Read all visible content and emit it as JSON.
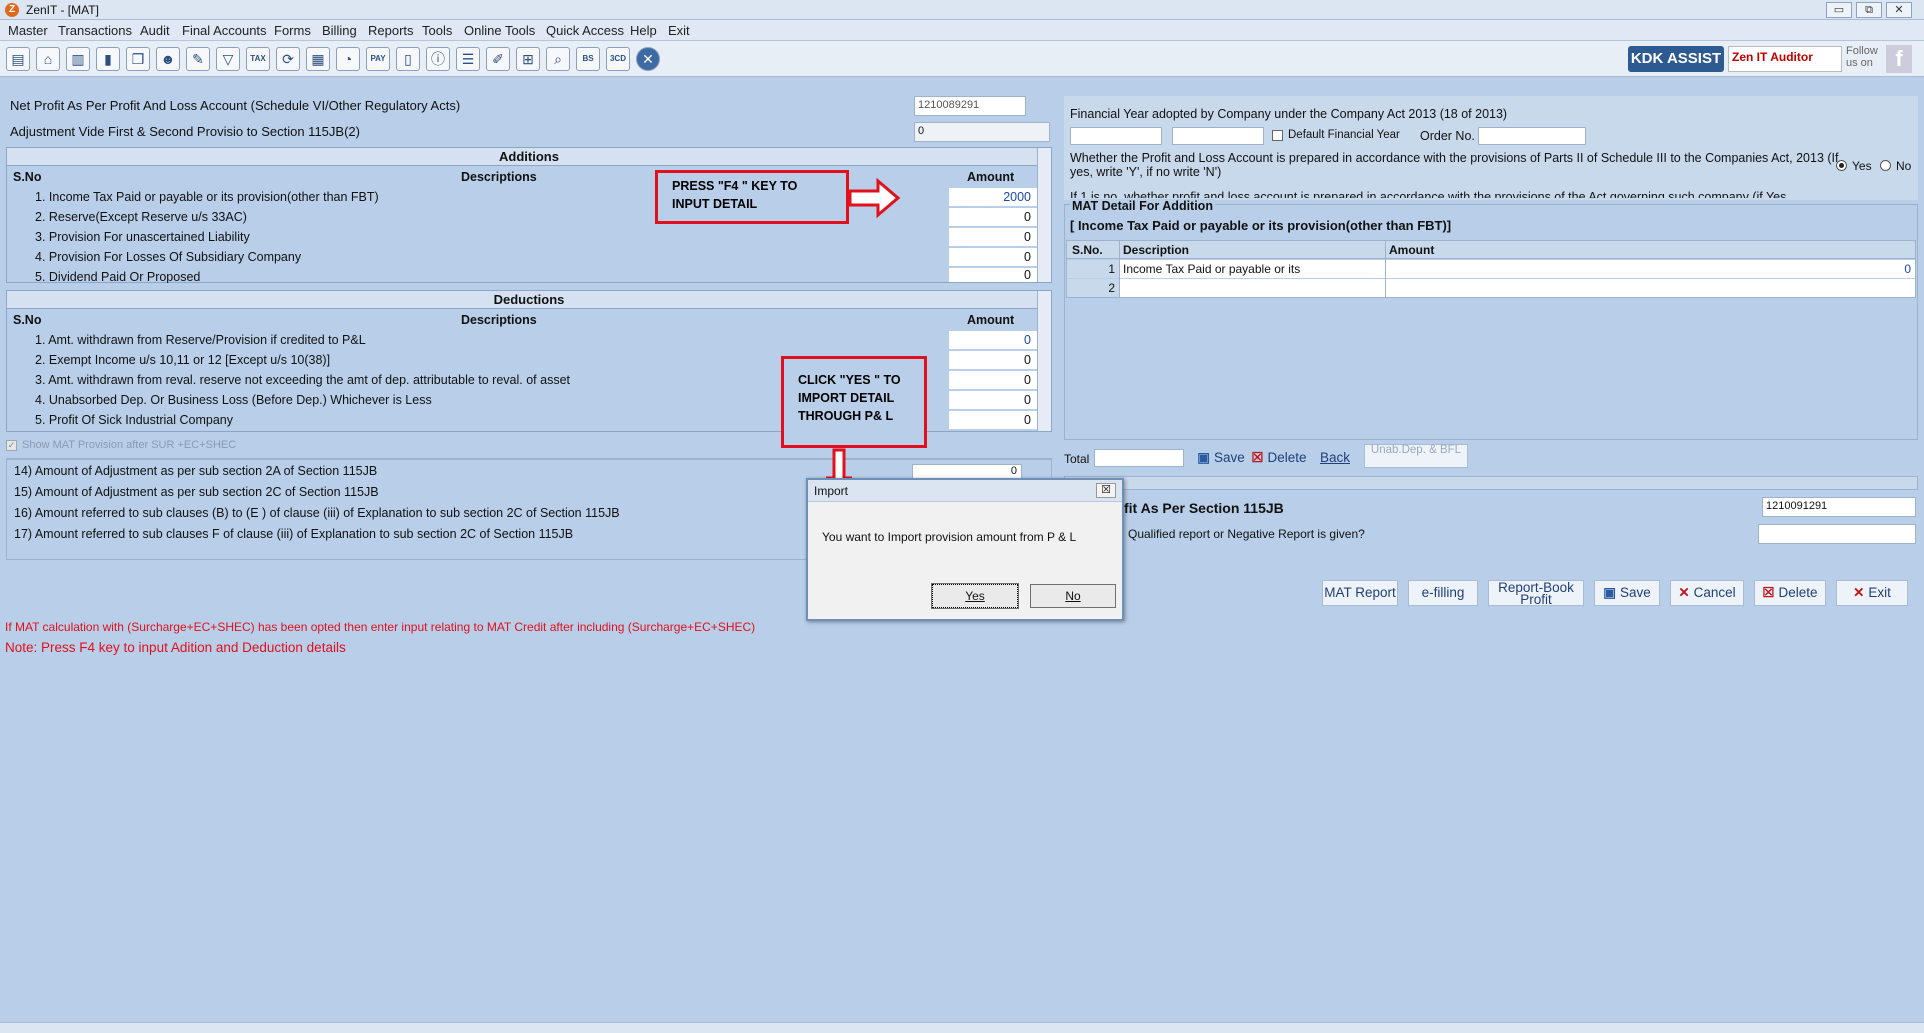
{
  "window": {
    "title": "ZenIT - [MAT]",
    "app_icon": "Z",
    "min": "▭",
    "restore": "⧉",
    "close": "✕"
  },
  "menu": [
    "Master",
    "Transactions",
    "Audit",
    "Final Accounts",
    "Forms",
    "Billing",
    "Reports",
    "Tools",
    "Online Tools",
    "Quick Access",
    "Help",
    "Exit"
  ],
  "toolbar": {
    "tax_label": "TAX",
    "bs_label": "BS",
    "sd_label": "3CD",
    "pay_label": "PAY"
  },
  "brand": {
    "kdk": "KDK ASSIST",
    "zen": "Zen IT Auditor",
    "follow": "Follow us on",
    "fb": "f"
  },
  "top": {
    "net_profit_label": "Net Profit As Per Profit And Loss Account (Schedule VI/Other Regulatory Acts)",
    "net_profit_value": "1210089291",
    "adjustment_label": "Adjustment Vide First & Second Provisio to Section 115JB(2)",
    "adjustment_value": "0"
  },
  "additions": {
    "title": "Additions",
    "col_sno": "S.No",
    "col_desc": "Descriptions",
    "col_amt": "Amount",
    "rows": [
      {
        "label": "1.  Income Tax Paid or payable or its provision(other than FBT)",
        "amount": "2000"
      },
      {
        "label": "2.  Reserve(Except Reserve u/s 33AC)",
        "amount": "0"
      },
      {
        "label": "3.  Provision For unascertained Liability",
        "amount": "0"
      },
      {
        "label": "4.  Provision For Losses Of Subsidiary Company",
        "amount": "0"
      },
      {
        "label": "5.  Dividend Paid Or Proposed",
        "amount": "0"
      }
    ]
  },
  "deductions": {
    "title": "Deductions",
    "col_sno": "S.No",
    "col_desc": "Descriptions",
    "col_amt": "Amount",
    "rows": [
      {
        "label": "1.  Amt. withdrawn from Reserve/Provision if credited to P&L",
        "amount": "0"
      },
      {
        "label": "2.  Exempt Income u/s 10,11 or 12 [Except u/s 10(38)]",
        "amount": "0"
      },
      {
        "label": "3.  Amt. withdrawn from reval. reserve not exceeding the amt of dep. attributable to reval. of asset",
        "amount": "0"
      },
      {
        "label": "4.  Unabsorbed Dep. Or Business Loss (Before Dep.) Whichever is Less",
        "amount": "0"
      },
      {
        "label": "5.  Profit Of Sick Industrial Company",
        "amount": "0"
      }
    ]
  },
  "show_mat_label": "Show MAT Provision after SUR +EC+SHEC",
  "lower_items": [
    "14)  Amount of Adjustment as per sub section 2A of Section 115JB",
    "15)  Amount of Adjustment as per sub section 2C of Section 115JB",
    "16)  Amount referred to sub clauses (B) to (E ) of clause (iii) of Explanation to sub section 2C of Section 115JB",
    "17)  Amount referred to sub clauses F of clause (iii) of Explanation to sub section 2C of Section 115JB"
  ],
  "item14_value": "0",
  "callouts": {
    "f4": "PRESS \"F4 \" KEY TO INPUT DETAIL",
    "yes": "CLICK \"YES \" TO IMPORT DETAIL THROUGH P& L"
  },
  "right": {
    "fy_label": "Financial Year adopted by Company under the Company Act 2013 (18 of 2013)",
    "default_fy": "Default Financial Year",
    "order_no": "Order No.",
    "pl_question": "Whether the Profit and Loss Account is prepared in accordance with the provisions of Parts II of Schedule III to the Companies Act, 2013 (If yes, write 'Y', if no write 'N')",
    "yes": "Yes",
    "no": "No",
    "cutoff": "If 1 is no, whether profit and loss account is prepared in accordance with the provisions of the Act governing such company (if Yes",
    "mat_detail_title": "MAT Detail For Addition",
    "mat_detail_sub": "[ Income Tax Paid or payable or its provision(other than FBT)]",
    "col_sno": "S.No.",
    "col_desc": "Description",
    "col_amt": "Amount",
    "rows": [
      {
        "sno": "1",
        "desc": "Income Tax Paid or payable or its",
        "amt": "0"
      },
      {
        "sno": "2",
        "desc": "",
        "amt": ""
      }
    ],
    "total_label": "Total",
    "save": "Save",
    "delete": "Delete",
    "back": "Back",
    "unab": "Unab.Dep. & BFL",
    "book_profit_label": "fit As Per Section 115JB",
    "book_profit_value": "1210091291",
    "qualified_label": "Qualified report or Negative Report is given?"
  },
  "bottom_buttons": {
    "mat_report": "MAT Report",
    "efiling": "e-filling",
    "report_book": "Report-Book Profit",
    "save": "Save",
    "cancel": "Cancel",
    "delete": "Delete",
    "exit": "Exit"
  },
  "notes": {
    "line1": "If MAT calculation with (Surcharge+EC+SHEC) has been opted then enter input relating to MAT Credit after including (Surcharge+EC+SHEC)",
    "line2": "Note: Press F4 key to input Adition and Deduction details"
  },
  "dialog": {
    "title": "Import",
    "message": "You want to Import provision amount from P & L",
    "yes": "Yes",
    "no": "No",
    "close": "☒"
  },
  "colors": {
    "bg": "#b9cfe9",
    "accent_red": "#e0101c",
    "brand_blue": "#2c5a91"
  }
}
